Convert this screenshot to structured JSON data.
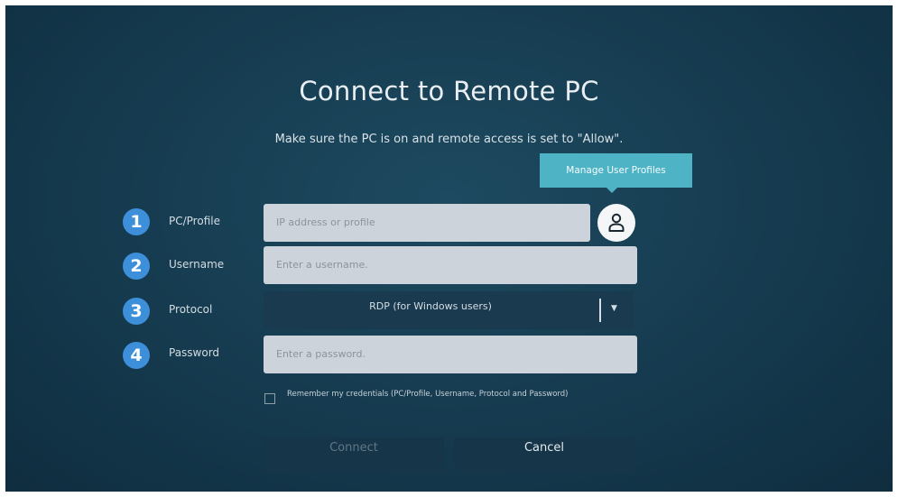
{
  "dialog": {
    "title": "Connect to Remote PC",
    "subtitle": "Make sure the PC is on and remote access is set to \"Allow\"."
  },
  "tooltip": {
    "text": "Manage User Profiles"
  },
  "fields": [
    {
      "number": "1",
      "label": "PC/Profile",
      "placeholder": "IP address or profile"
    },
    {
      "number": "2",
      "label": "Username",
      "placeholder": "Enter a username."
    },
    {
      "number": "3",
      "label": "Protocol",
      "value": "RDP (for Windows users)"
    },
    {
      "number": "4",
      "label": "Password",
      "placeholder": "Enter a password."
    }
  ],
  "remember": {
    "label": "Remember my credentials (PC/Profile, Username, Protocol and Password)",
    "checked": false
  },
  "buttons": {
    "connect": "Connect",
    "cancel": "Cancel"
  },
  "icons": {
    "profile": "user-icon",
    "dropdown": "chevron-down-icon"
  },
  "colors": {
    "background": "#173d52",
    "accent": "#4fb3c6",
    "step_number": "#3d8fd9",
    "field": "#ccd3da"
  }
}
